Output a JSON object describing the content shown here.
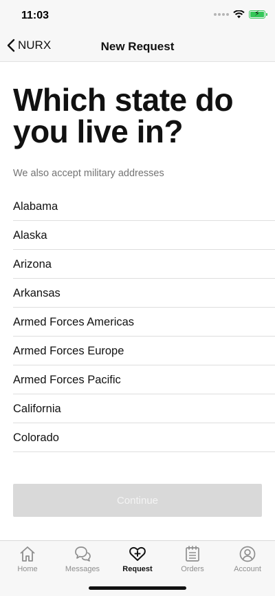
{
  "status_bar": {
    "time": "11:03"
  },
  "nav": {
    "back_label": "NURX",
    "title": "New Request"
  },
  "page": {
    "title": "Which state do you live in?",
    "subtitle": "We also accept military addresses"
  },
  "states": [
    "Alabama",
    "Alaska",
    "Arizona",
    "Arkansas",
    "Armed Forces Americas",
    "Armed Forces Europe",
    "Armed Forces Pacific",
    "California",
    "Colorado"
  ],
  "continue_label": "Continue",
  "tabs": [
    {
      "label": "Home",
      "icon": "home-icon",
      "active": false
    },
    {
      "label": "Messages",
      "icon": "messages-icon",
      "active": false
    },
    {
      "label": "Request",
      "icon": "heart-plus-icon",
      "active": true
    },
    {
      "label": "Orders",
      "icon": "calendar-list-icon",
      "active": false
    },
    {
      "label": "Account",
      "icon": "user-circle-icon",
      "active": false
    }
  ],
  "colors": {
    "button_disabled": "#d9d9d9",
    "battery": "#34c759",
    "tab_inactive": "#8e8e8e",
    "tab_active": "#111111"
  }
}
